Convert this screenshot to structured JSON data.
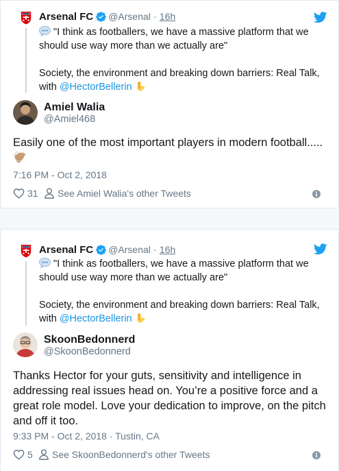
{
  "colors": {
    "accent": "#1b95e0",
    "muted": "#657786",
    "thread_line": "#ccd6dd",
    "twitter_blue": "#1da1f2"
  },
  "tweets": [
    {
      "parent": {
        "name": "Arsenal FC",
        "handle": "@Arsenal",
        "separator": "·",
        "time": "16h",
        "line1": "\"I think as footballers, we have a massive platform that we",
        "line2": "should use way more than we actually are\"",
        "line3": "Society, the environment and breaking down barriers: Real Talk,",
        "line4_prefix": "with ",
        "mention": "@HectorBellerin",
        "emoji_speech": "speech-balloon-emoji",
        "emoji_point": "backhand-index-pointing-down-emoji"
      },
      "reply": {
        "name": "Amiel Walia",
        "handle": "@Amiel468",
        "text_lines": [
          "Easily one of the most important players in modern football....."
        ],
        "emoji": "clapping-hands-emoji",
        "timestamp": "7:16 PM - Oct 2, 2018",
        "like_count": "31",
        "see_other": "See Amiel Walia's other Tweets"
      }
    },
    {
      "parent": {
        "name": "Arsenal FC",
        "handle": "@Arsenal",
        "separator": "·",
        "time": "16h",
        "line1": "\"I think as footballers, we have a massive platform that we",
        "line2": "should use way more than we actually are\"",
        "line3": "Society, the environment and breaking down barriers: Real Talk,",
        "line4_prefix": "with ",
        "mention": "@HectorBellerin",
        "emoji_speech": "speech-balloon-emoji",
        "emoji_point": "backhand-index-pointing-down-emoji"
      },
      "reply": {
        "name": "SkoonBedonnerd",
        "handle": "@SkoonBedonnerd",
        "text_lines": [
          "Thanks Hector for your guts, sensitivity and intelligence in",
          "addressing real issues head on. You’re a positive force and a",
          "great role model. Love your dedication to improve, on the pitch",
          "and off it too."
        ],
        "timestamp": "9:33 PM - Oct 2, 2018 · Tustin, CA",
        "like_count": "5",
        "see_other": "See SkoonBedonnerd's other Tweets"
      }
    }
  ]
}
